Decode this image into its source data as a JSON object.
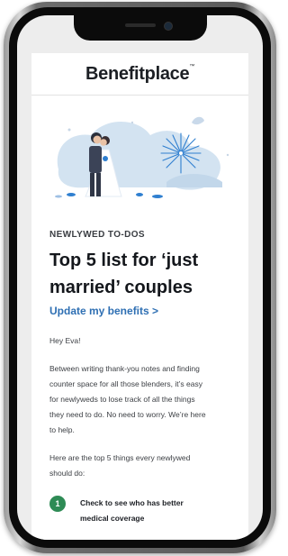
{
  "brand": {
    "name": "Benefitplace",
    "trademark": "™"
  },
  "email": {
    "eyebrow": "NEWLYWED TO-DOS",
    "headline_line1": "Top 5 list for ‘just",
    "headline_line2": "married’ couples",
    "cta": "Update my benefits >",
    "greeting": "Hey Eva!",
    "para1_lines": [
      "Between writing thank-you notes and finding",
      "counter space for all those blenders, it’s easy",
      "for newlyweds to lose track of all the things",
      "they need to do. No need to worry. We’re here",
      "to help."
    ],
    "para2_lines": [
      "Here are the top 5 things every newlywed",
      "should do:"
    ],
    "list": [
      {
        "number": "1",
        "text_line1": "Check to see who has better",
        "text_line2": "medical coverage"
      }
    ]
  },
  "icons": [
    "wedding-couple-illustration",
    "fireworks-icon"
  ],
  "colors": {
    "link": "#2e6fb3",
    "badge": "#2e8b55",
    "hero_blob": "#d3e3f1",
    "text": "#14171c"
  }
}
